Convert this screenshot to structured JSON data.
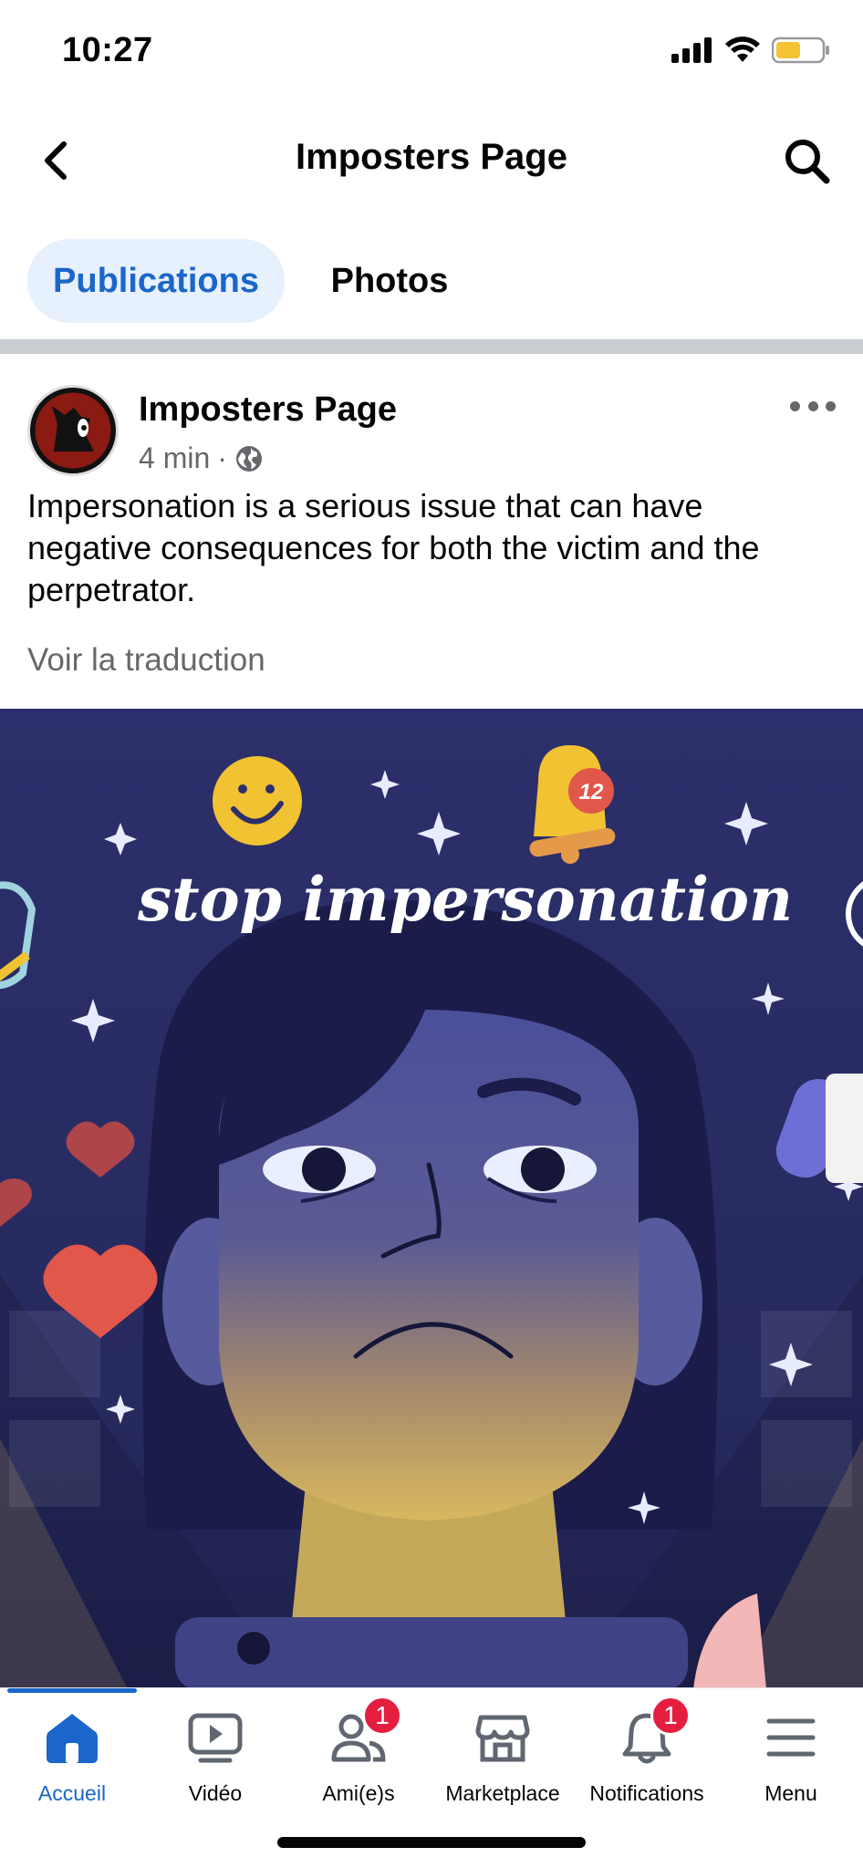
{
  "status_bar": {
    "time": "10:27"
  },
  "header": {
    "title": "Imposters Page"
  },
  "tabs": [
    {
      "label": "Publications",
      "active": true
    },
    {
      "label": "Photos",
      "active": false
    }
  ],
  "post": {
    "author": "Imposters Page",
    "time": "4 min",
    "separator": "·",
    "audience_icon": "globe-icon",
    "text": "Impersonation is a serious issue that can have negative consequences for both the victim and the perpetrator.",
    "translate_label": "Voir la traduction",
    "image": {
      "headline": "stop impersonation",
      "bell_count": "12"
    }
  },
  "bottom_nav": [
    {
      "label": "Accueil",
      "icon": "home-icon",
      "active": true
    },
    {
      "label": "Vidéo",
      "icon": "video-icon",
      "active": false
    },
    {
      "label": "Ami(e)s",
      "icon": "friends-icon",
      "badge": "1",
      "active": false
    },
    {
      "label": "Marketplace",
      "icon": "marketplace-icon",
      "active": false
    },
    {
      "label": "Notifications",
      "icon": "notifications-bell-icon",
      "badge": "1",
      "active": false
    },
    {
      "label": "Menu",
      "icon": "hamburger-menu-icon",
      "active": false
    }
  ],
  "colors": {
    "accent": "#1b66c9",
    "badge": "#e41e3f",
    "image_bg": "#2c2f6b"
  }
}
